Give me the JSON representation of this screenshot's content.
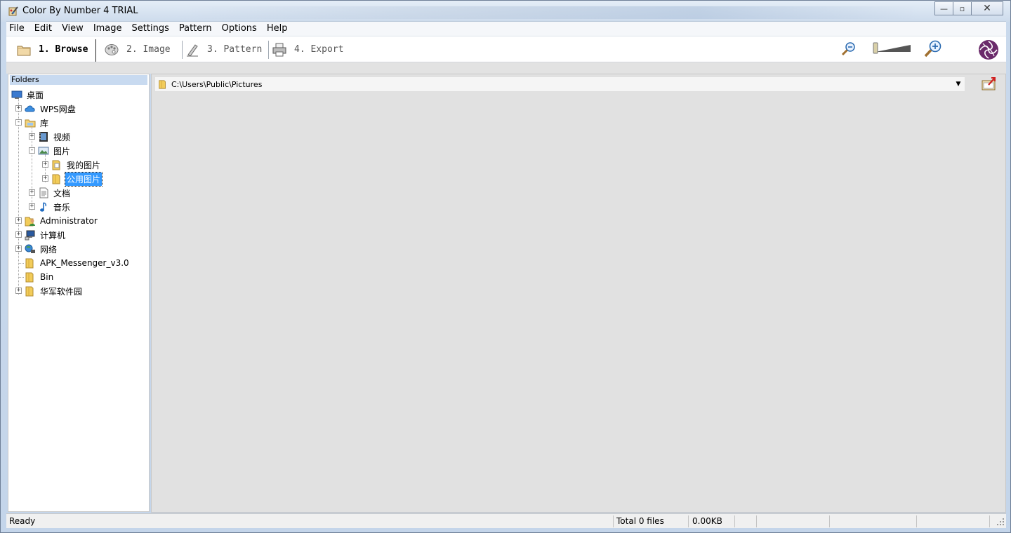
{
  "window": {
    "title": "Color By Number 4 TRIAL",
    "buttons": {
      "minimize": "—",
      "maximize": "▫",
      "close": "✕"
    }
  },
  "menu": [
    "File",
    "Edit",
    "View",
    "Image",
    "Settings",
    "Pattern",
    "Options",
    "Help"
  ],
  "steps": [
    {
      "label": "1. Browse",
      "icon": "folder-icon",
      "active": true
    },
    {
      "label": "2. Image",
      "icon": "palette-icon",
      "active": false
    },
    {
      "label": "3. Pattern",
      "icon": "pen-icon",
      "active": false
    },
    {
      "label": "4. Export",
      "icon": "printer-icon",
      "active": false
    }
  ],
  "toolbar_right": {
    "zoom_out_icon": "zoom-out-icon",
    "zoom_slider_icon": "zoom-slider",
    "zoom_in_icon": "zoom-in-icon",
    "logo_icon": "app-logo-icon"
  },
  "folders": {
    "header": "Folders",
    "items": [
      {
        "label": "桌面",
        "icon": "desktop-icon",
        "level": 0,
        "expander": ""
      },
      {
        "label": "WPS网盘",
        "icon": "cloud-icon",
        "level": 1,
        "expander": "+"
      },
      {
        "label": "库",
        "icon": "library-icon",
        "level": 1,
        "expander": "-"
      },
      {
        "label": "视频",
        "icon": "video-icon",
        "level": 2,
        "expander": "+"
      },
      {
        "label": "图片",
        "icon": "pictures-icon",
        "level": 2,
        "expander": "-"
      },
      {
        "label": "我的图片",
        "icon": "folder-icon",
        "level": 3,
        "expander": "+"
      },
      {
        "label": "公用图片",
        "icon": "folder-icon",
        "level": 3,
        "expander": "+",
        "selected": true
      },
      {
        "label": "文档",
        "icon": "document-icon",
        "level": 2,
        "expander": "+"
      },
      {
        "label": "音乐",
        "icon": "music-icon",
        "level": 2,
        "expander": "+"
      },
      {
        "label": "Administrator",
        "icon": "user-icon",
        "level": 1,
        "expander": "+"
      },
      {
        "label": "计算机",
        "icon": "computer-icon",
        "level": 1,
        "expander": "+"
      },
      {
        "label": "网络",
        "icon": "network-icon",
        "level": 1,
        "expander": "+"
      },
      {
        "label": "APK_Messenger_v3.0",
        "icon": "folder-icon",
        "level": 1,
        "expander": ""
      },
      {
        "label": "Bin",
        "icon": "folder-icon",
        "level": 1,
        "expander": ""
      },
      {
        "label": "华军软件园",
        "icon": "folder-icon",
        "level": 1,
        "expander": "+"
      }
    ]
  },
  "path": {
    "value": "C:\\Users\\Public\\Pictures",
    "dropdown_icon": "dropdown-arrow-icon",
    "export_icon": "export-folder-icon"
  },
  "status": {
    "state": "Ready",
    "total": "Total 0 files",
    "size": "0.00KB"
  }
}
